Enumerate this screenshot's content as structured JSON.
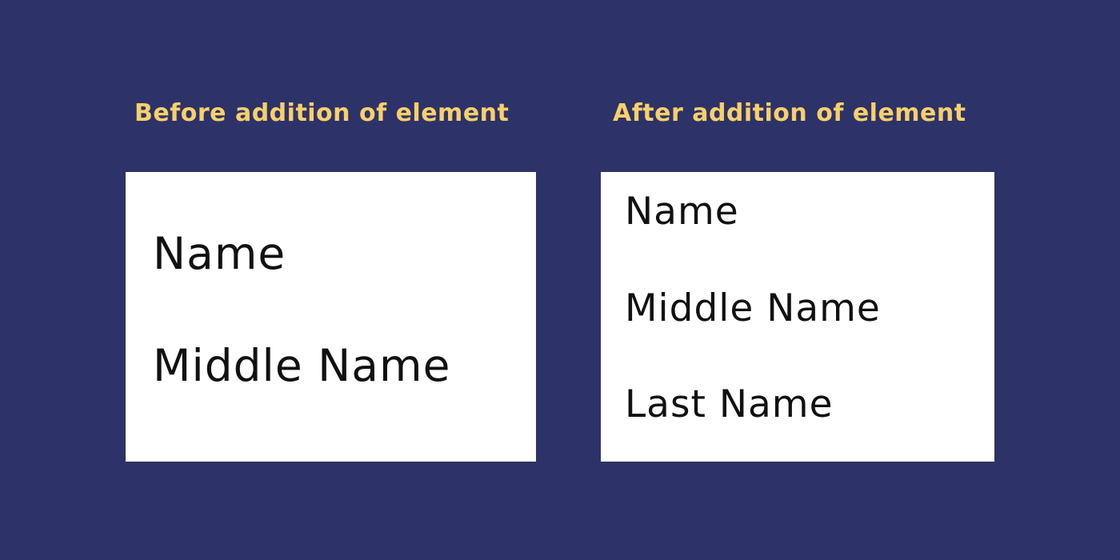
{
  "panels": [
    {
      "title": "Before addition of element",
      "fields": [
        "Name",
        "Middle Name"
      ]
    },
    {
      "title": "After addition of element",
      "fields": [
        "Name",
        "Middle Name",
        "Last Name"
      ]
    }
  ],
  "colors": {
    "background": "#2d3268",
    "title": "#f7d06b",
    "card": "#ffffff",
    "text": "#111111"
  }
}
